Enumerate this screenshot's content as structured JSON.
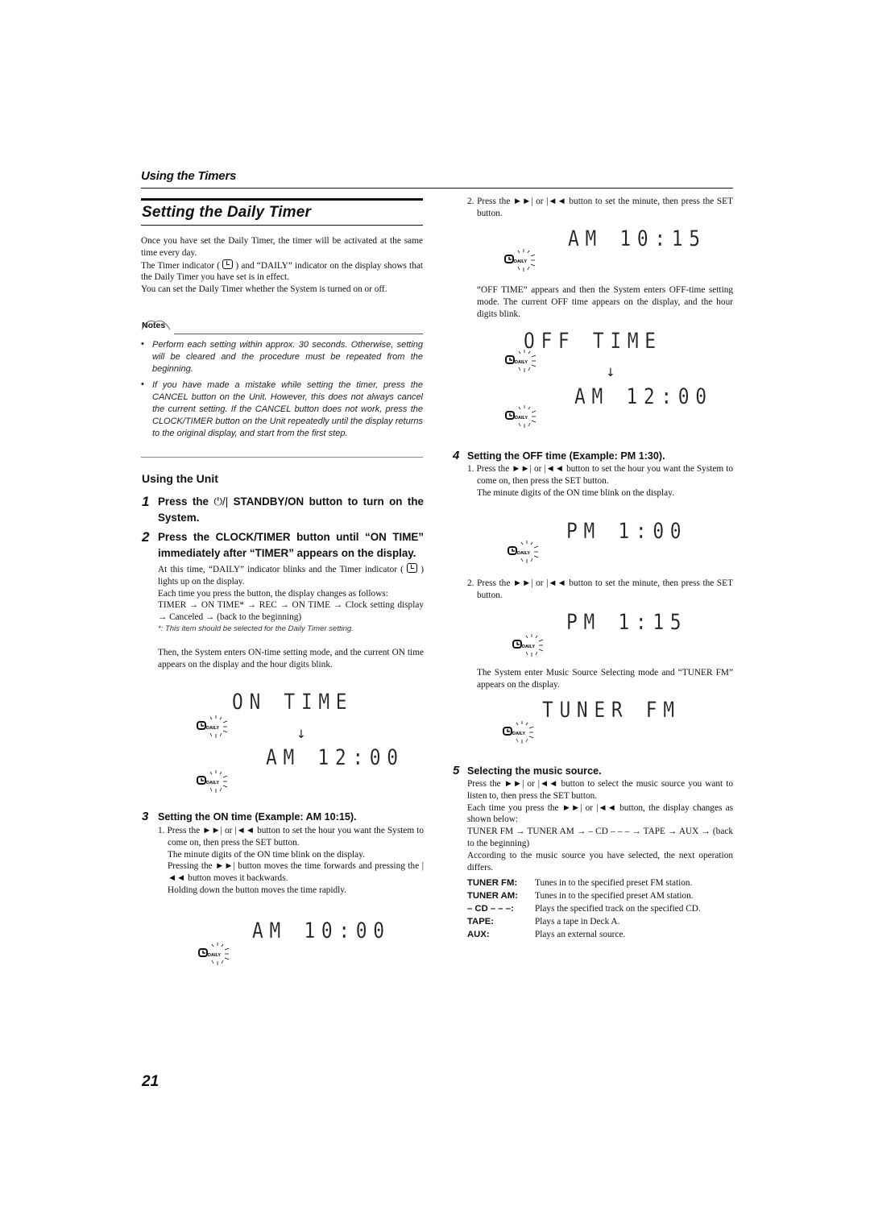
{
  "section_header": "Using the Timers",
  "page_title": "Setting the Daily Timer",
  "intro": [
    "Once you have set the Daily Timer, the timer will be activated at the same time every day.",
    "The Timer indicator ( ",
    " ) and “DAILY” indicator on the display shows that the Daily Timer you have set is in effect.",
    "You can set the Daily Timer whether the System is turned on or off."
  ],
  "notes": {
    "heading": "Notes",
    "items": [
      "Perform each setting within approx. 30 seconds. Otherwise, setting will be cleared and the procedure must be repeated from the beginning.",
      "If you have made a mistake while setting the timer, press the CANCEL button on the Unit. However, this does not always cancel the current setting. If the CANCEL button does not work, press the CLOCK/TIMER button on the Unit repeatedly until the display returns to the original display, and start from the first step."
    ]
  },
  "using_unit": {
    "heading": "Using the Unit",
    "step1": {
      "num": "1",
      "text_a": "Press the ",
      "icon": "⏻/|",
      "text_b": " STANDBY/ON button to turn on the System."
    },
    "step2": {
      "num": "2",
      "text": "Press the CLOCK/TIMER button until “ON TIME” immediately after “TIMER” appears on the display.",
      "body_a": "At this time, “DAILY” indicator blinks and the Timer indicator ( ",
      "body_b": " ) lights up on the display.",
      "body_c": "Each time you press the button, the display changes as follows:",
      "sequence": "TIMER → ON TIME* → REC → ON TIME → Clock setting display → Canceled → (back to the beginning)",
      "footnote": "*: This item should be selected for the Daily Timer setting.",
      "after": "Then, the System enters ON-time setting mode, and the current ON time appears on the display and the hour digits blink.",
      "display_1": "ON  TIME",
      "display_2": "AM 12:00"
    },
    "step3": {
      "num": "3",
      "title": "Setting the ON time (Example: AM 10:15).",
      "sub1_a": "1. Press the ►►| or |◄◄ button to set the hour you want the System to come on, then press the SET button.",
      "sub1_b": "The minute digits of the ON time blink on the display.",
      "sub1_c": "Pressing the ►►| button moves the time forwards and pressing the |◄◄ button moves it backwards.",
      "sub1_d": "Holding down the button moves the time rapidly.",
      "display_1": "AM 10:00",
      "sub2": "2. Press the ►►| or |◄◄ button to set the minute, then press the SET button.",
      "display_2": "AM 10:15",
      "after": "“OFF TIME” appears and then the System enters OFF-time setting mode. The current OFF time appears on the display, and the hour digits blink.",
      "display_3": "OFF  TIME",
      "display_4": "AM 12:00"
    },
    "step4": {
      "num": "4",
      "title": "Setting the OFF time (Example: PM 1:30).",
      "sub1_a": "1. Press the ►►| or |◄◄ button to set the hour you want the System to come on, then press the SET button.",
      "sub1_b": "The minute digits of the ON time blink on the display.",
      "display_1": "PM  1:00",
      "sub2": "2. Press the ►►| or |◄◄ button to set the minute, then press the SET button.",
      "display_2": "PM  1:15",
      "after": "The System enter Music Source Selecting mode and “TUNER FM” appears on the display.",
      "display_3": "TUNER  FM"
    },
    "step5": {
      "num": "5",
      "title": "Selecting the music source.",
      "p1": "Press the ►►| or |◄◄ button to select the music source you want to listen to, then press the SET button.",
      "p2": "Each time you press the ►►| or |◄◄ button, the display changes as shown below:",
      "sequence": "TUNER FM → TUNER AM → – CD – – – → TAPE → AUX → (back to the beginning)",
      "p3": "According to the music source you have selected, the next operation differs.",
      "sources": [
        {
          "term": "TUNER FM:",
          "desc": "Tunes in to the specified preset FM station."
        },
        {
          "term": "TUNER AM:",
          "desc": "Tunes in to the specified preset AM station."
        },
        {
          "term": "– CD – – –:",
          "desc": "Plays the specified track on the specified CD."
        },
        {
          "term": "TAPE:",
          "desc": "Plays a tape in Deck A."
        },
        {
          "term": "AUX:",
          "desc": "Plays an external source."
        }
      ]
    }
  },
  "daily_label": "DAILY",
  "down_arrow": "↓",
  "page_number": "21"
}
